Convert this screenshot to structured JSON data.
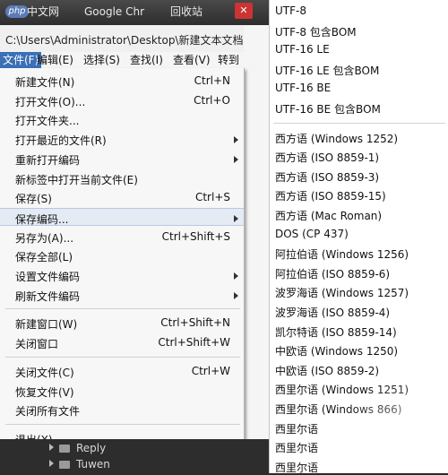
{
  "taskbar": {
    "items": [
      "中文网",
      "Google Chr",
      "回收站"
    ],
    "close_label": "✕"
  },
  "path": "C:\\Users\\Administrator\\Desktop\\新建文本文档.h",
  "menubar": [
    "文件(F)",
    "编辑(E)",
    "选择(S)",
    "查找(I)",
    "查看(V)",
    "转到"
  ],
  "file_menu": {
    "groups": [
      [
        {
          "label": "新建文件(N)",
          "shortcut": "Ctrl+N",
          "submenu": false
        },
        {
          "label": "打开文件(O)...",
          "shortcut": "Ctrl+O",
          "submenu": false
        },
        {
          "label": "打开文件夹...",
          "shortcut": "",
          "submenu": false
        },
        {
          "label": "打开最近的文件(R)",
          "shortcut": "",
          "submenu": true
        },
        {
          "label": "重新打开编码",
          "shortcut": "",
          "submenu": true
        },
        {
          "label": "新标签中打开当前文件(E)",
          "shortcut": "",
          "submenu": false
        },
        {
          "label": "保存(S)",
          "shortcut": "Ctrl+S",
          "submenu": false
        },
        {
          "label": "保存编码...",
          "shortcut": "",
          "submenu": true,
          "hover": true
        },
        {
          "label": "另存为(A)...",
          "shortcut": "Ctrl+Shift+S",
          "submenu": false
        },
        {
          "label": "保存全部(L)",
          "shortcut": "",
          "submenu": false
        },
        {
          "label": "设置文件编码",
          "shortcut": "",
          "submenu": true
        },
        {
          "label": "刷新文件编码",
          "shortcut": "",
          "submenu": true
        }
      ],
      [
        {
          "label": "新建窗口(W)",
          "shortcut": "Ctrl+Shift+N",
          "submenu": false
        },
        {
          "label": "关闭窗口",
          "shortcut": "Ctrl+Shift+W",
          "submenu": false
        }
      ],
      [
        {
          "label": "关闭文件(C)",
          "shortcut": "Ctrl+W",
          "submenu": false
        },
        {
          "label": "恢复文件(V)",
          "shortcut": "",
          "submenu": false
        },
        {
          "label": "关闭所有文件",
          "shortcut": "",
          "submenu": false
        }
      ],
      [
        {
          "label": "退出(X)",
          "shortcut": "",
          "submenu": false
        }
      ]
    ]
  },
  "explorer": [
    "Reply",
    "Tuwen"
  ],
  "encoding_menu": {
    "groups": [
      [
        "UTF-8",
        "UTF-8 包含BOM",
        "UTF-16 LE",
        "UTF-16 LE 包含BOM",
        "UTF-16 BE",
        "UTF-16 BE 包含BOM"
      ],
      [
        "西方语 (Windows 1252)",
        "西方语 (ISO 8859-1)",
        "西方语 (ISO 8859-3)",
        "西方语 (ISO 8859-15)",
        "西方语 (Mac Roman)",
        "DOS (CP 437)",
        "阿拉伯语 (Windows 1256)",
        "阿拉伯语 (ISO 8859-6)",
        "波罗海语 (Windows 1257)",
        "波罗海语 (ISO 8859-4)",
        "凯尔特语 (ISO 8859-14)",
        "中欧语 (Windows 1250)",
        "中欧语 (ISO 8859-2)",
        "西里尔语 (Windows 1251)",
        "西里尔语 (Windows 866)",
        "西里尔语",
        "西里尔语",
        "西里尔语"
      ]
    ]
  },
  "colors": {
    "menu_active": "#3b6fb6",
    "hover_bg": "#e4ebf5"
  }
}
